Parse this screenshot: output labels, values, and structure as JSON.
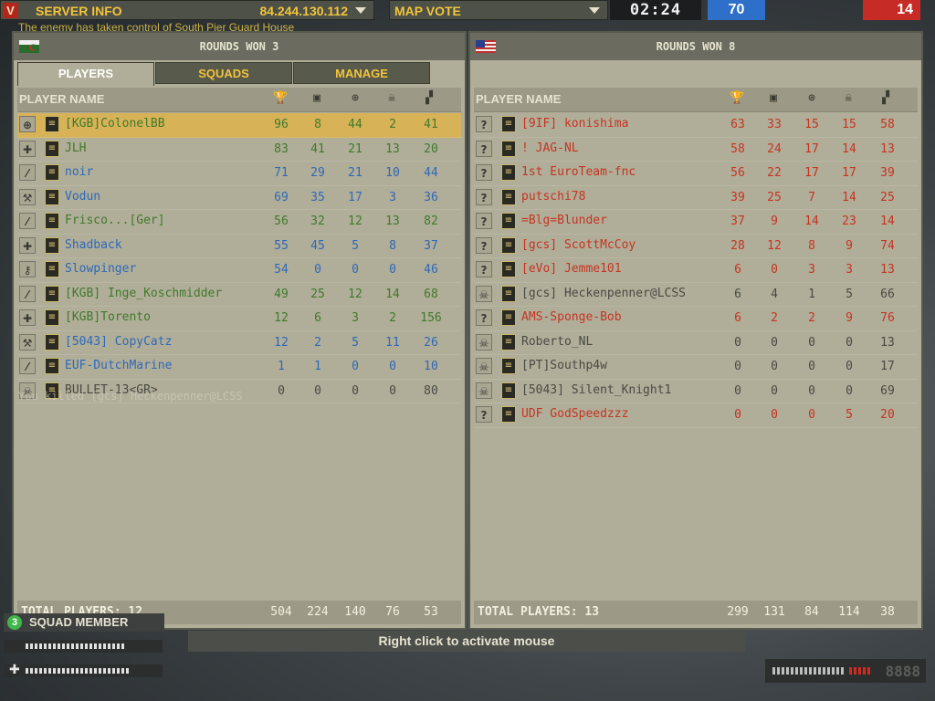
{
  "server": {
    "logo": "V",
    "title": "SERVER INFO",
    "ip": "84.244.130.112"
  },
  "mapvote": {
    "label": "MAP VOTE"
  },
  "timer": "02:24",
  "scores": {
    "blue": "70",
    "red": "14"
  },
  "message": "The enemy has taken control of South Pier Guard House",
  "left": {
    "rounds_won": "ROUNDS WON 3",
    "tabs": [
      "PLAYERS",
      "SQUADS",
      "MANAGE"
    ],
    "col_player_name": "PLAYER NAME",
    "players": [
      {
        "name": "[KGB]ColonelBB",
        "vals": [
          "96",
          "8",
          "44",
          "2",
          "41"
        ],
        "cls": "⊕",
        "color": "green",
        "highlight": true
      },
      {
        "name": "JLH",
        "vals": [
          "83",
          "41",
          "21",
          "13",
          "20"
        ],
        "cls": "✚",
        "color": "green"
      },
      {
        "name": "noir",
        "vals": [
          "71",
          "29",
          "21",
          "10",
          "44"
        ],
        "cls": "⁄",
        "color": "blue"
      },
      {
        "name": "Vodun",
        "vals": [
          "69",
          "35",
          "17",
          "3",
          "36"
        ],
        "cls": "⚒",
        "color": "blue"
      },
      {
        "name": "Frisco...[Ger]",
        "vals": [
          "56",
          "32",
          "12",
          "13",
          "82"
        ],
        "cls": "⁄",
        "color": "green"
      },
      {
        "name": "Shadback",
        "vals": [
          "55",
          "45",
          "5",
          "8",
          "37"
        ],
        "cls": "✚",
        "color": "blue"
      },
      {
        "name": "Slowpinger",
        "vals": [
          "54",
          "0",
          "0",
          "0",
          "46"
        ],
        "cls": "⚷",
        "color": "blue"
      },
      {
        "name": "[KGB] Inge_Koschmidder",
        "vals": [
          "49",
          "25",
          "12",
          "14",
          "68"
        ],
        "cls": "⁄",
        "color": "green"
      },
      {
        "name": "[KGB]Torento",
        "vals": [
          "12",
          "6",
          "3",
          "2",
          "156"
        ],
        "cls": "✚",
        "color": "green"
      },
      {
        "name": "[5043] CopyCatz",
        "vals": [
          "12",
          "2",
          "5",
          "11",
          "26"
        ],
        "cls": "⚒",
        "color": "blue"
      },
      {
        "name": "EUF-DutchMarine",
        "vals": [
          "1",
          "1",
          "0",
          "0",
          "10"
        ],
        "cls": "⁄",
        "color": "blue"
      },
      {
        "name": "BULLET-13<GR>",
        "vals": [
          "0",
          "0",
          "0",
          "0",
          "80"
        ],
        "cls": "☠",
        "color": "gray"
      }
    ],
    "total_label": "TOTAL PLAYERS: 12",
    "totals": [
      "504",
      "224",
      "140",
      "76",
      "53"
    ],
    "kill_message": "You killed [gcs] Heckenpenner@LCSS"
  },
  "right": {
    "rounds_won": "ROUNDS WON 8",
    "col_player_name": "PLAYER NAME",
    "players": [
      {
        "name": "[9IF] konishima",
        "vals": [
          "63",
          "33",
          "15",
          "15",
          "58"
        ],
        "cls": "?",
        "color": "red"
      },
      {
        "name": "! JAG-NL",
        "vals": [
          "58",
          "24",
          "17",
          "14",
          "13"
        ],
        "cls": "?",
        "color": "red"
      },
      {
        "name": "1st EuroTeam-fnc",
        "vals": [
          "56",
          "22",
          "17",
          "17",
          "39"
        ],
        "cls": "?",
        "color": "red"
      },
      {
        "name": "putschi78",
        "vals": [
          "39",
          "25",
          "7",
          "14",
          "25"
        ],
        "cls": "?",
        "color": "red"
      },
      {
        "name": "=Blg=Blunder",
        "vals": [
          "37",
          "9",
          "14",
          "23",
          "14"
        ],
        "cls": "?",
        "color": "red"
      },
      {
        "name": "[gcs] ScottMcCoy",
        "vals": [
          "28",
          "12",
          "8",
          "9",
          "74"
        ],
        "cls": "?",
        "color": "red"
      },
      {
        "name": "[eVo] Jemme101",
        "vals": [
          "6",
          "0",
          "3",
          "3",
          "13"
        ],
        "cls": "?",
        "color": "red"
      },
      {
        "name": "[gcs] Heckenpenner@LCSS",
        "vals": [
          "6",
          "4",
          "1",
          "5",
          "66"
        ],
        "cls": "☠",
        "color": "gray"
      },
      {
        "name": "AMS-Sponge-Bob",
        "vals": [
          "6",
          "2",
          "2",
          "9",
          "76"
        ],
        "cls": "?",
        "color": "red"
      },
      {
        "name": "Roberto_NL",
        "vals": [
          "0",
          "0",
          "0",
          "0",
          "13"
        ],
        "cls": "☠",
        "color": "gray"
      },
      {
        "name": "[PT]Southp4w",
        "vals": [
          "0",
          "0",
          "0",
          "0",
          "17"
        ],
        "cls": "☠",
        "color": "gray"
      },
      {
        "name": "[5043] Silent_Knight1",
        "vals": [
          "0",
          "0",
          "0",
          "0",
          "69"
        ],
        "cls": "☠",
        "color": "gray"
      },
      {
        "name": "UDF GodSpeedzzz",
        "vals": [
          "0",
          "0",
          "0",
          "5",
          "20"
        ],
        "cls": "?",
        "color": "red"
      }
    ],
    "total_label": "TOTAL PLAYERS: 13",
    "totals": [
      "299",
      "131",
      "84",
      "114",
      "38"
    ]
  },
  "squad": {
    "number": "3",
    "label": "SQUAD MEMBER"
  },
  "hint": "Right click to activate mouse",
  "ammo_count": "8888",
  "hud_levels": {
    "stamina": 0.78,
    "health": 0.82,
    "ammo": 0.65
  }
}
